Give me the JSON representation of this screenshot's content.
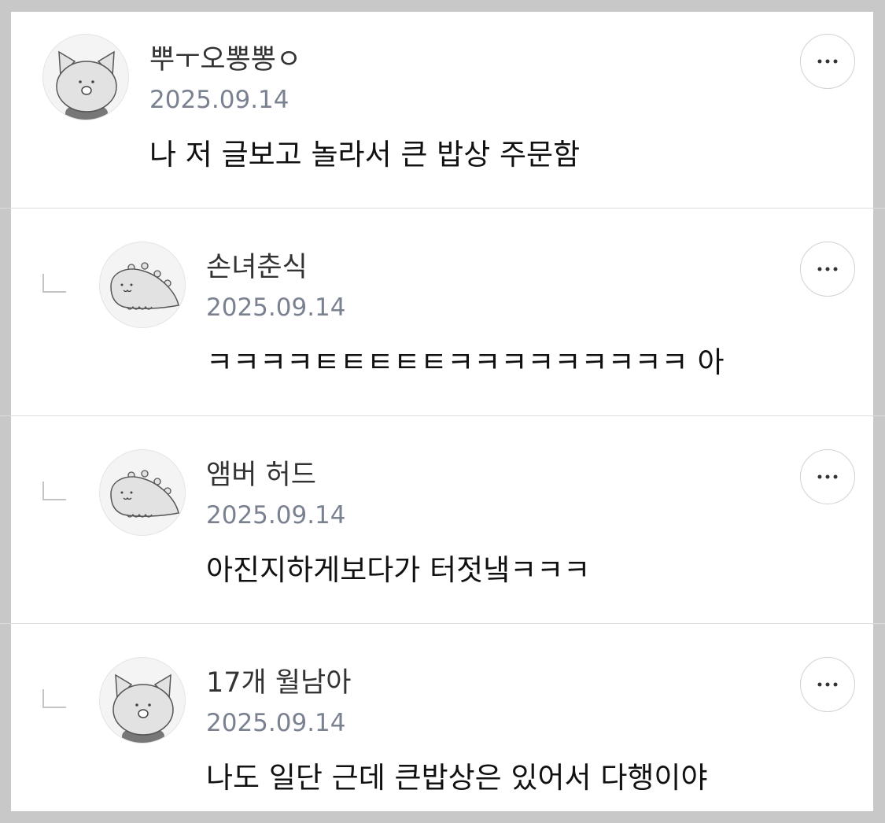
{
  "comments": [
    {
      "author": "뿌ㅜ오뽕뽕ㅇ",
      "date": "2025.09.14",
      "text": "나 저 글보고 놀라서 큰 밥상 주문함",
      "avatar_icon": "cat-avatar-icon",
      "is_reply": false
    },
    {
      "author": "손녀춘식",
      "date": "2025.09.14",
      "text": "ㅋㅋㅋㅋㅌㅌㅌㅌㅌㅋㅋㅋㅋㅋㅋㅋㅋㅋ 아",
      "avatar_icon": "dino-avatar-icon",
      "is_reply": true
    },
    {
      "author": "앰버 허드",
      "date": "2025.09.14",
      "text": "아진지하게보다가 터젓냌ㅋㅋㅋ",
      "avatar_icon": "dino-avatar-icon",
      "is_reply": true
    },
    {
      "author": "17개 월남아",
      "date": "2025.09.14",
      "text": "나도 일단 근데 큰밥상은 있어서 다행이야",
      "avatar_icon": "cat-avatar-icon",
      "is_reply": true
    }
  ],
  "more_button_icon": "more-dots-icon",
  "colors": {
    "author": "#333333",
    "date": "#7a8190",
    "body": "#111111",
    "divider": "#dcdcdc",
    "outer_bg": "#c8c8c8"
  }
}
